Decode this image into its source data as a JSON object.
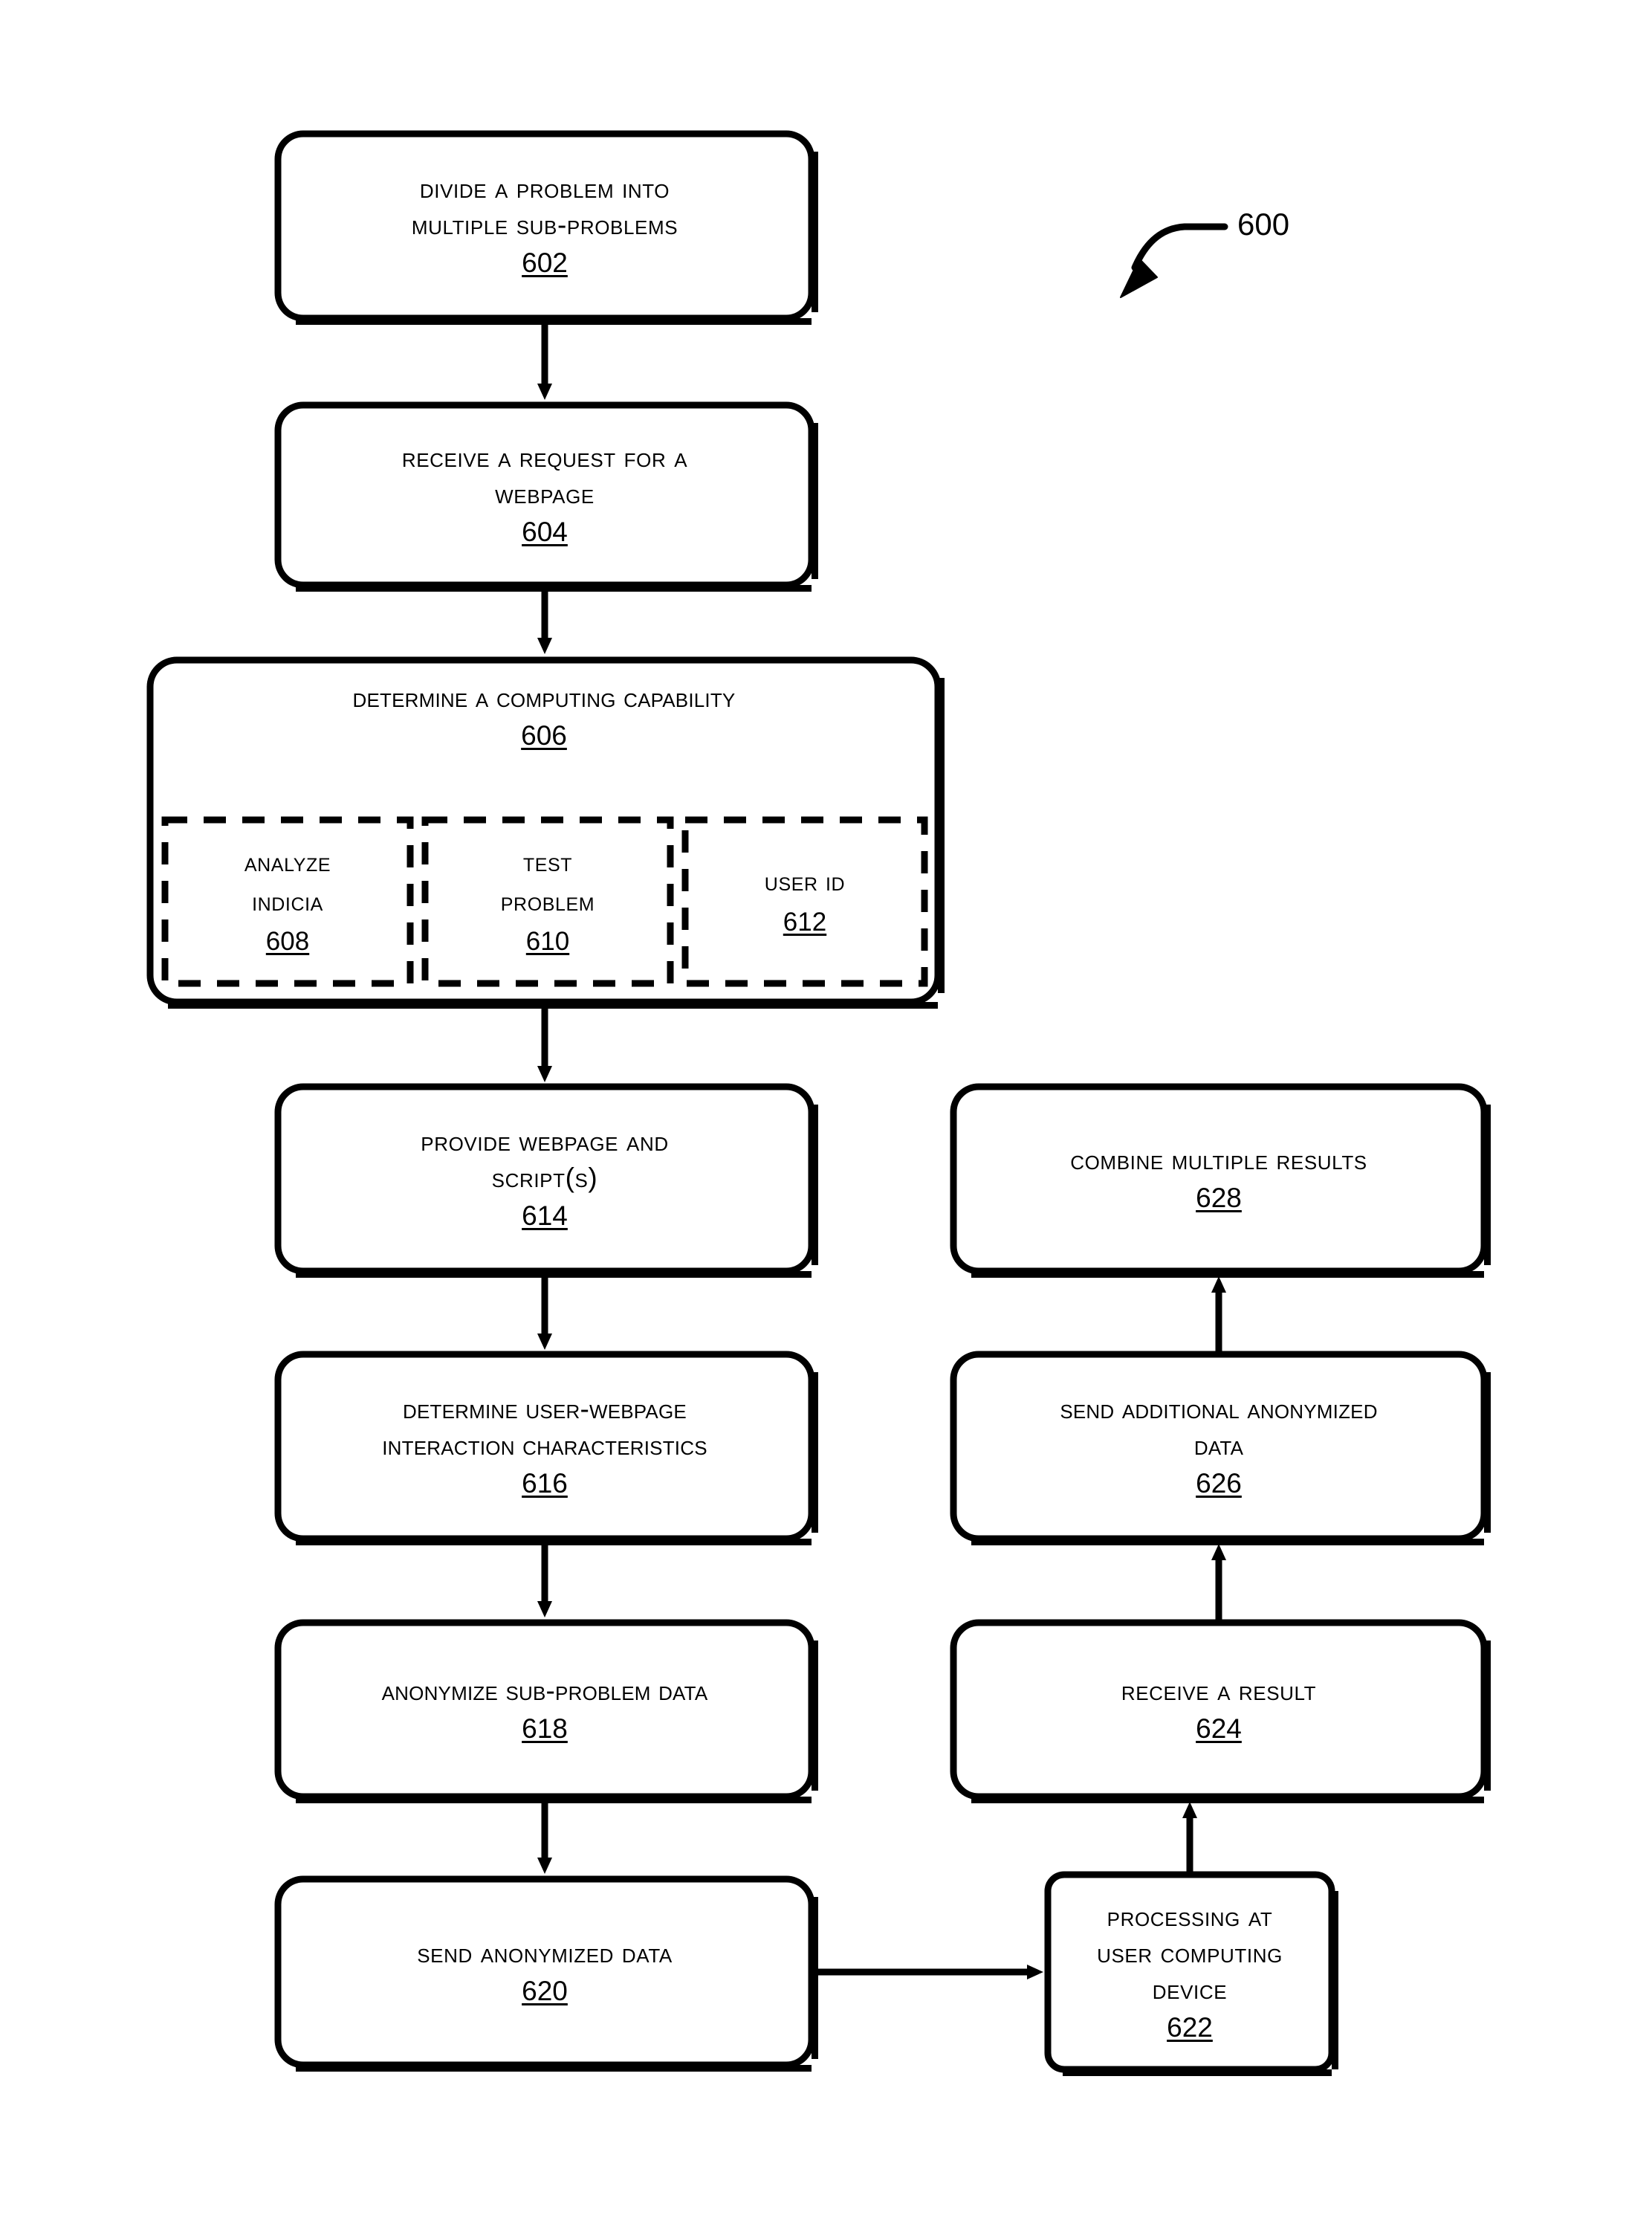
{
  "figure": {
    "reference_number": "600",
    "background_color": "#ffffff",
    "line_color": "#000000"
  },
  "nodes": [
    {
      "id": "602",
      "name": "divide-problem-box",
      "label": "Divide a Problem Into\nMultiple Sub-problems",
      "ref": "602",
      "shape": "rounded-rect",
      "style": "solid"
    },
    {
      "id": "604",
      "name": "receive-request-box",
      "label": "Receive a Request for a\nWebpage",
      "ref": "604",
      "shape": "rounded-rect",
      "style": "solid"
    },
    {
      "id": "606",
      "name": "determine-computing-capability-box",
      "label": "Determine a Computing Capability",
      "ref": "606",
      "shape": "rounded-rect",
      "style": "solid"
    },
    {
      "id": "608",
      "name": "analyze-indicia-subbox",
      "label": "Analyze\nIndicia",
      "ref": "608",
      "shape": "rect",
      "style": "dashed"
    },
    {
      "id": "610",
      "name": "test-problem-subbox",
      "label": "Test\nProblem",
      "ref": "610",
      "shape": "rect",
      "style": "dashed"
    },
    {
      "id": "612",
      "name": "user-id-subbox",
      "label": "User ID",
      "ref": "612",
      "shape": "rect",
      "style": "dashed"
    },
    {
      "id": "614",
      "name": "provide-webpage-box",
      "label": "Provide Webpage and\nScript(s)",
      "ref": "614",
      "shape": "rounded-rect",
      "style": "solid"
    },
    {
      "id": "616",
      "name": "determine-interaction-box",
      "label": "Determine User-webpage\nInteraction Characteristics",
      "ref": "616",
      "shape": "rounded-rect",
      "style": "solid"
    },
    {
      "id": "618",
      "name": "anonymize-data-box",
      "label": "Anonymize Sub-problem Data",
      "ref": "618",
      "shape": "rounded-rect",
      "style": "solid"
    },
    {
      "id": "620",
      "name": "send-anonymized-data-box",
      "label": "Send Anonymized Data",
      "ref": "620",
      "shape": "rounded-rect",
      "style": "solid"
    },
    {
      "id": "622",
      "name": "processing-at-user-device-box",
      "label": "Processing at\nUser Computing\nDevice",
      "ref": "622",
      "shape": "rounded-rect",
      "style": "solid"
    },
    {
      "id": "624",
      "name": "receive-result-box",
      "label": "Receive a Result",
      "ref": "624",
      "shape": "rounded-rect",
      "style": "solid"
    },
    {
      "id": "626",
      "name": "send-additional-data-box",
      "label": "Send Additional Anonymized\nData",
      "ref": "626",
      "shape": "rounded-rect",
      "style": "solid"
    },
    {
      "id": "628",
      "name": "combine-results-box",
      "label": "Combine Multiple Results",
      "ref": "628",
      "shape": "rounded-rect",
      "style": "solid"
    }
  ],
  "edges": [
    {
      "name": "edge-602-604",
      "from": "602",
      "to": "604",
      "direction": "down"
    },
    {
      "name": "edge-604-606",
      "from": "604",
      "to": "606",
      "direction": "down"
    },
    {
      "name": "edge-606-614",
      "from": "606",
      "to": "614",
      "direction": "down"
    },
    {
      "name": "edge-614-616",
      "from": "614",
      "to": "616",
      "direction": "down"
    },
    {
      "name": "edge-616-618",
      "from": "616",
      "to": "618",
      "direction": "down"
    },
    {
      "name": "edge-618-620",
      "from": "618",
      "to": "620",
      "direction": "down"
    },
    {
      "name": "edge-620-622",
      "from": "620",
      "to": "622",
      "direction": "right"
    },
    {
      "name": "edge-622-624",
      "from": "622",
      "to": "624",
      "direction": "up"
    },
    {
      "name": "edge-624-626",
      "from": "624",
      "to": "626",
      "direction": "up"
    },
    {
      "name": "edge-626-628",
      "from": "626",
      "to": "628",
      "direction": "up"
    }
  ]
}
